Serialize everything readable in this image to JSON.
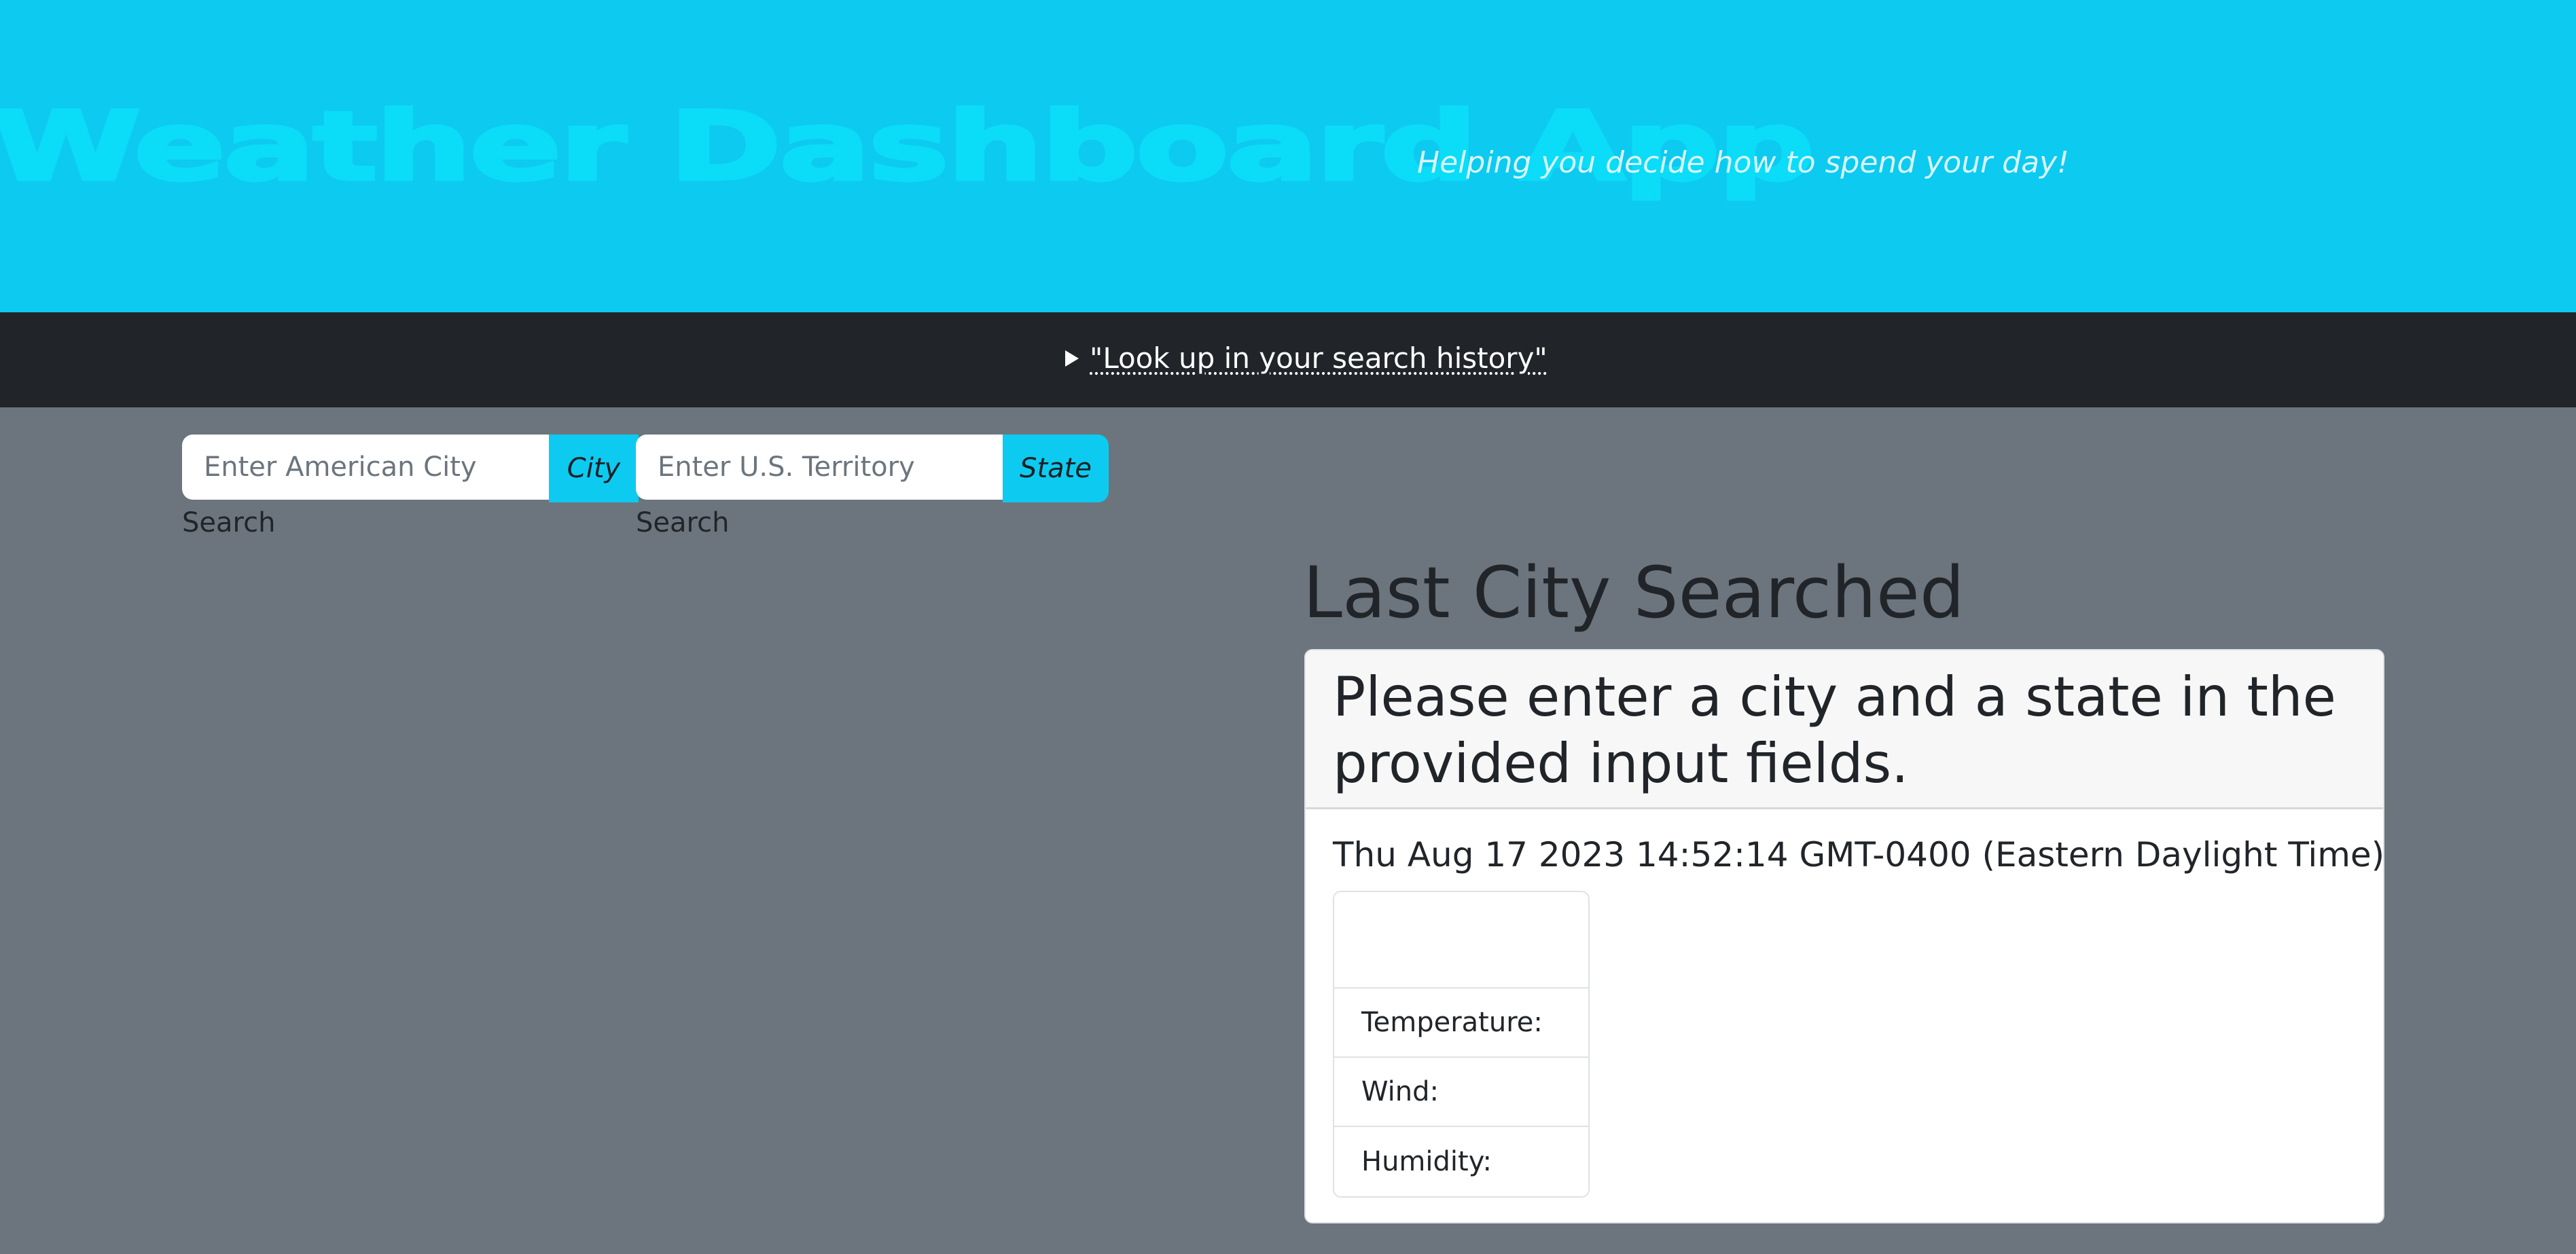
{
  "header": {
    "title": "Weather Dashboard App",
    "subtitle": "Helping you decide how to spend your day!"
  },
  "search_history": {
    "summary": "\"Look up in your search history\""
  },
  "search": {
    "city": {
      "placeholder": "Enter American City",
      "button_label": "City",
      "label": "Search"
    },
    "state": {
      "placeholder": "Enter U.S. Territory",
      "button_label": "State",
      "label": "Search"
    }
  },
  "last_city": {
    "heading": "Last City Searched",
    "card_header": "Please enter a city and a state in the provided input fields.",
    "date": "Thu Aug 17 2023 14:52:14 GMT-0400 (Eastern Daylight Time)",
    "forecast": {
      "temperature_label": "Temperature:",
      "wind_label": "Wind:",
      "humidity_label": "Humidity:"
    }
  },
  "colors": {
    "header_bg": "#0dcaf0",
    "history_bar_bg": "#212529",
    "page_bg": "#6c757d",
    "button_bg": "#0dcaf0"
  }
}
